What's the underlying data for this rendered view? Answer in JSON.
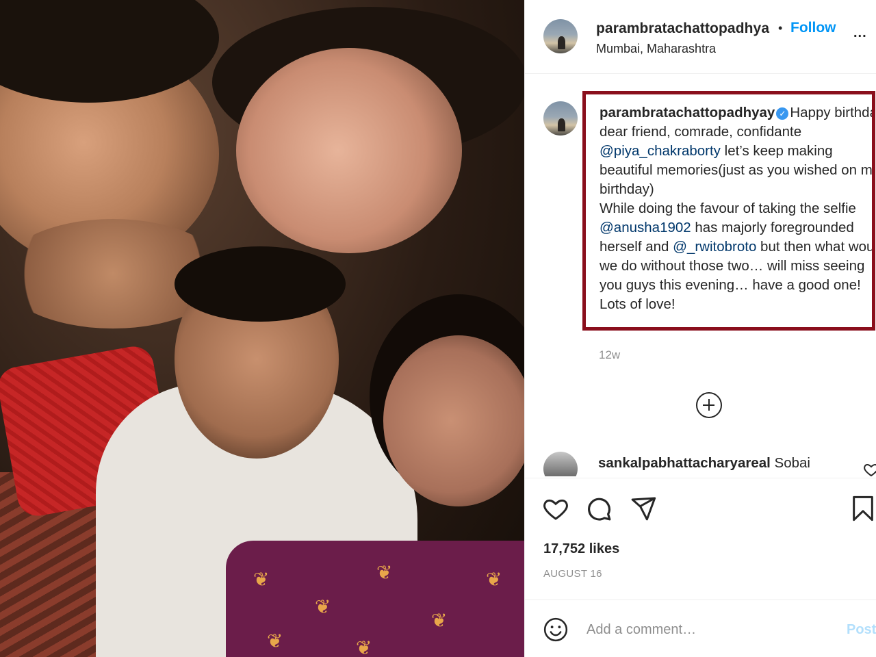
{
  "post": {
    "username": "parambratachattopadhya",
    "separator": "•",
    "follow_label": "Follow",
    "location": "Mumbai, Maharashtra",
    "more_label": "...",
    "photo_icon": "group-selfie-photo"
  },
  "caption": {
    "username": "parambratachattopadhyay",
    "verified_icon": "verified-badge-icon",
    "text_1": "Happy birthday dear friend, comrade, confidante ",
    "mention_1": "@piya_chakraborty",
    "text_2": " let’s keep making beautiful memories(just as you wished on my birthday)\nWhile doing the favour of taking the selfie ",
    "mention_2": "@anusha1902",
    "text_3": " has majorly foregrounded herself and ",
    "mention_3": "@_rwitobroto",
    "text_4": " but then what would we do without those two… will miss seeing you guys this evening… have a good one! Lots of love!",
    "highlight_color": "#8a0f1c",
    "timestamp": "12w"
  },
  "comments": [
    {
      "username": "sankalpabhattacharyareal",
      "text": "Sobai"
    }
  ],
  "actions": {
    "like_icon": "heart-icon",
    "comment_icon": "comment-icon",
    "share_icon": "share-icon",
    "save_icon": "bookmark-icon",
    "load_more_icon": "plus-circle-icon",
    "likes_text": "17,752 likes",
    "date_text": "AUGUST 16"
  },
  "add_comment": {
    "emoji_icon": "smiley-icon",
    "placeholder": "Add a comment…",
    "post_label": "Post"
  },
  "colors": {
    "link_blue": "#0095f6",
    "text": "#262626",
    "muted": "#8e8e8e",
    "disabled_blue": "#b2dffc"
  }
}
